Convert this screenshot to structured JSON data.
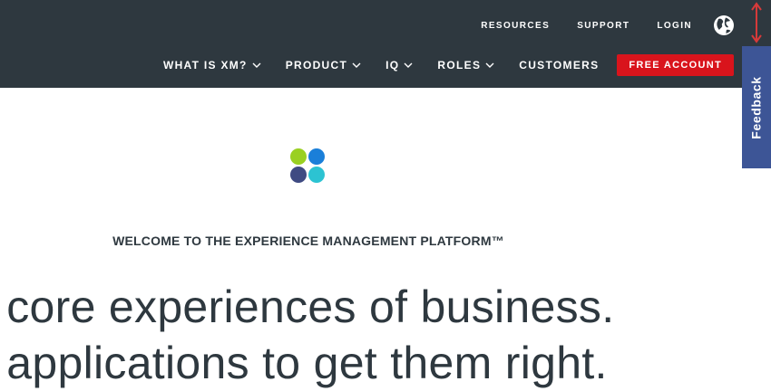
{
  "header": {
    "utility_nav": [
      {
        "label": "RESOURCES"
      },
      {
        "label": "SUPPORT"
      },
      {
        "label": "LOGIN"
      }
    ],
    "main_nav": [
      {
        "label": "WHAT IS XM?",
        "has_dropdown": true
      },
      {
        "label": "PRODUCT",
        "has_dropdown": true
      },
      {
        "label": "IQ",
        "has_dropdown": true
      },
      {
        "label": "ROLES",
        "has_dropdown": true
      },
      {
        "label": "CUSTOMERS",
        "has_dropdown": false
      }
    ],
    "cta_label": "FREE ACCOUNT",
    "globe_icon": "globe-icon"
  },
  "feedback": {
    "label": "Feedback"
  },
  "hero": {
    "logo_colors": [
      "#9ad021",
      "#1a7fd9",
      "#3f4a82",
      "#2cc3d2"
    ],
    "eyebrow": "WELCOME TO THE EXPERIENCE MANAGEMENT PLATFORM™",
    "headline_lines": [
      "ur core experiences of business.",
      "ur applications to get them right."
    ]
  },
  "colors": {
    "header_bg": "#2e383f",
    "cta_red": "#d9141c",
    "feedback_blue": "#3d5596",
    "text_dark": "#2e383f",
    "arrow_red": "#d63a3a"
  }
}
